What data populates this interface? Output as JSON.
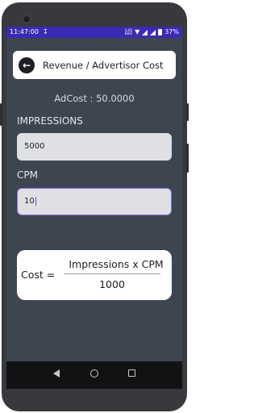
{
  "status_bar": {
    "time": "11:47:00",
    "speed_value": "0.00",
    "speed_unit": "KB/S",
    "battery": "37%"
  },
  "app_bar": {
    "title": "Revenue / Advertisor Cost",
    "back_icon": "arrow-left-icon"
  },
  "result": {
    "text": "AdCost : 50.0000"
  },
  "impressions": {
    "label": "IMPRESSIONS",
    "value": "5000"
  },
  "cpm": {
    "label": "CPM",
    "value": "10"
  },
  "formula": {
    "lhs": "Cost =",
    "numerator": "Impressions x CPM",
    "denominator": "1000"
  },
  "colors": {
    "status_bar": "#3b2ab3",
    "screen_bg": "#3d4551",
    "focus_border": "#8a6fe0"
  }
}
